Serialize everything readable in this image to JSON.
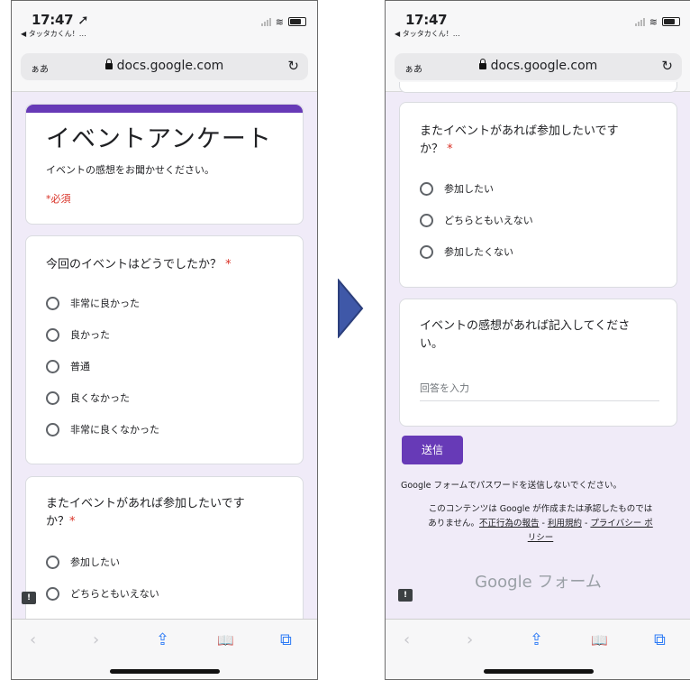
{
  "left_phone": {
    "status": {
      "time": "17:47 ➚",
      "back_app": "◀ タッタカくん！…"
    },
    "url": {
      "aa": "ぁあ",
      "domain": "docs.google.com",
      "reload": "↻"
    },
    "header_card": {
      "title": "イベントアンケート",
      "description": "イベントの感想をお聞かせください。",
      "required_note": "*必須"
    },
    "q1": {
      "title": "今回のイベントはどうでしたか？",
      "required_mark": "*",
      "options": [
        "非常に良かった",
        "良かった",
        "普通",
        "良くなかった",
        "非常に良くなかった"
      ]
    },
    "q2": {
      "title_line1": "またイベントがあれば参加したいです",
      "title_line2": "か？",
      "required_mark": "*",
      "options": [
        "参加したい",
        "どちらともいえない"
      ]
    }
  },
  "right_phone": {
    "status": {
      "time": "17:47",
      "back_app": "◀ タッタカくん！…"
    },
    "url": {
      "aa": "ぁあ",
      "domain": "docs.google.com",
      "reload": "↻"
    },
    "q2": {
      "title_line1": "またイベントがあれば参加したいです",
      "title_line2": "か？",
      "required_mark": "*",
      "options": [
        "参加したい",
        "どちらともいえない",
        "参加したくない"
      ]
    },
    "q3": {
      "title_line1": "イベントの感想があれば記入してくださ",
      "title_line2": "い。",
      "placeholder": "回答を入力"
    },
    "submit_label": "送信",
    "password_note": "Google フォームでパスワードを送信しないでください。",
    "disclaimer": {
      "line1": "このコンテンツは Google が作成または承認したものでは",
      "line2_prefix": "ありません。",
      "link_report": "不正行為の報告",
      "sep": " - ",
      "link_terms": "利用規約",
      "link_privacy_a": "プライバシー ポ",
      "link_privacy_b": "リシー"
    },
    "footer_brand": "Google フォーム"
  },
  "toolbar": {
    "back": "‹",
    "forward": "›",
    "share": "⇪",
    "bookmarks": "📖",
    "tabs": "⧉"
  },
  "feedback_icon": "!",
  "colors": {
    "accent": "#673ab7",
    "required": "#d93025",
    "background": "#f0ebf8",
    "arrow": "#3f58a8"
  }
}
